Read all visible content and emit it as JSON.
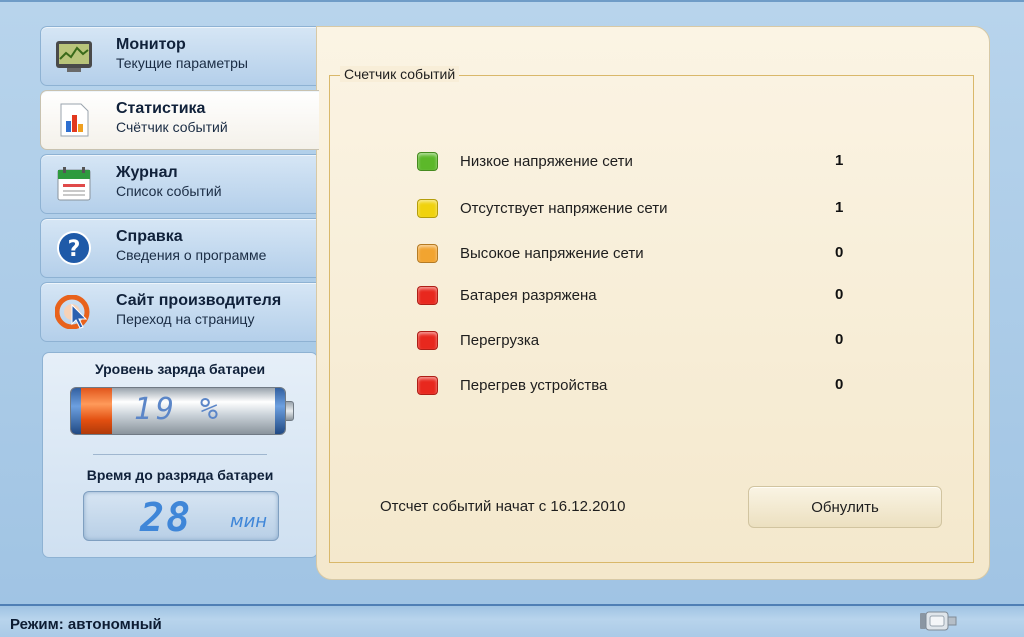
{
  "nav": {
    "items": [
      {
        "title": "Монитор",
        "subtitle": "Текущие параметры",
        "icon": "monitor-icon",
        "active": false
      },
      {
        "title": "Статистика",
        "subtitle": "Счётчик событий",
        "icon": "chart-icon",
        "active": true
      },
      {
        "title": "Журнал",
        "subtitle": "Список событий",
        "icon": "calendar-icon",
        "active": false
      },
      {
        "title": "Справка",
        "subtitle": "Сведения о программе",
        "icon": "help-icon",
        "active": false
      },
      {
        "title": "Сайт производителя",
        "subtitle": "Переход на страницу",
        "icon": "web-cursor-icon",
        "active": false
      }
    ]
  },
  "battery": {
    "charge_title": "Уровень заряда батареи",
    "charge_text": "19 %",
    "charge_level": 0.19,
    "time_title": "Время до разряда батареи",
    "time_value": "28",
    "time_unit": "мин"
  },
  "events": {
    "group_label": "Счетчик событий",
    "rows": [
      {
        "label": "Низкое напряжение сети",
        "count": "1",
        "color": "#5cb82a"
      },
      {
        "label": "Отсутствует напряжение сети",
        "count": "1",
        "color": "#f0d20e"
      },
      {
        "label": "Высокое напряжение сети",
        "count": "0",
        "color": "#f2a430"
      },
      {
        "label": "Батарея разряжена",
        "count": "0",
        "color": "#e8281e"
      },
      {
        "label": "Перегрузка",
        "count": "0",
        "color": "#e8281e"
      },
      {
        "label": "Перегрев устройства",
        "count": "0",
        "color": "#e8281e"
      }
    ],
    "since_text": "Отсчет событий начат с 16.12.2010",
    "reset_label": "Обнулить"
  },
  "status": {
    "mode_text": "Режим: автономный",
    "connection_icon": "rs-port-icon"
  },
  "colors": {
    "accent_blue": "#3f86d8",
    "panel_beige": "#f4e8cc",
    "group_border": "#d9b86a"
  }
}
